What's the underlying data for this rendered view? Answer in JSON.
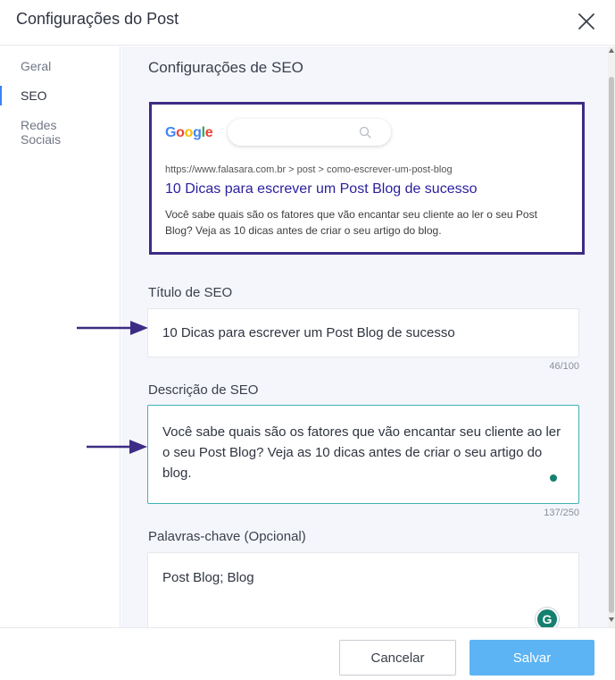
{
  "dialog": {
    "title": "Configurações do Post"
  },
  "sidebar": {
    "items": [
      {
        "label": "Geral",
        "active": false
      },
      {
        "label": "SEO",
        "active": true
      },
      {
        "label": "Redes Sociais",
        "active": false
      }
    ]
  },
  "main": {
    "section_title": "Configurações de SEO",
    "preview": {
      "logo_text": "Google",
      "url": "https://www.falasara.com.br > post > como-escrever-um-post-blog",
      "title": "10 Dicas para escrever um Post Blog de sucesso",
      "description": "Você sabe quais são os fatores que vão encantar seu cliente ao ler o seu Post Blog? Veja as 10 dicas antes de criar o seu artigo do blog."
    },
    "seo_title": {
      "label": "Título de SEO",
      "value": "10 Dicas para escrever um Post Blog de sucesso",
      "counter": "46/100"
    },
    "seo_description": {
      "label": "Descrição de SEO",
      "value": "Você sabe quais são os fatores que vão encantar seu cliente ao ler o seu Post Blog? Veja as 10 dicas antes de criar o seu artigo do blog.",
      "counter": "137/250"
    },
    "keywords": {
      "label": "Palavras-chave (Opcional)",
      "value": "Post Blog; Blog"
    }
  },
  "footer": {
    "cancel_label": "Cancelar",
    "save_label": "Salvar"
  },
  "colors": {
    "accent": "#5cb4f4",
    "preview_border": "#3d2b85",
    "link": "#2a1f9e",
    "arrow": "#3d2b85",
    "grammarly": "#15806f"
  },
  "icons": {
    "close": "close-icon",
    "search": "search-icon",
    "arrow": "arrow-right-icon",
    "grammarly": "grammarly-icon"
  }
}
